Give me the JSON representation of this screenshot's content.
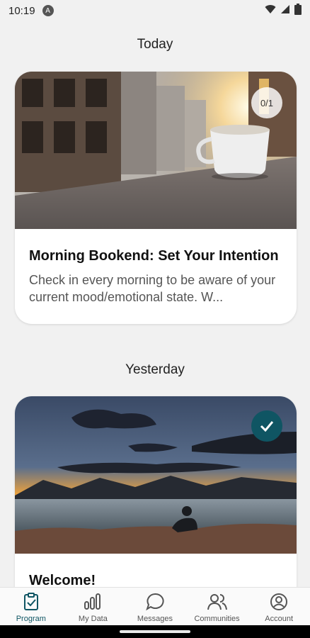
{
  "status_bar": {
    "time": "10:19",
    "app_icon": "A"
  },
  "sections": [
    {
      "label": "Today",
      "card": {
        "title": "Morning Bookend: Set Your Intention",
        "description": "Check in every morning to be aware of your current mood/emotional state. W...",
        "progress": "0/1",
        "image": "coffee-cup-on-ledge"
      }
    },
    {
      "label": "Yesterday",
      "card": {
        "title": "Welcome!",
        "completed": true,
        "image": "sunset-lake-silhouette"
      }
    }
  ],
  "nav": {
    "items": [
      {
        "label": "Program",
        "icon": "clipboard-check-icon",
        "active": true
      },
      {
        "label": "My Data",
        "icon": "bar-chart-icon"
      },
      {
        "label": "Messages",
        "icon": "chat-bubble-icon"
      },
      {
        "label": "Communities",
        "icon": "people-icon"
      },
      {
        "label": "Account",
        "icon": "account-circle-icon"
      }
    ]
  },
  "colors": {
    "accent": "#0f5563",
    "background": "#f1f1f1"
  }
}
